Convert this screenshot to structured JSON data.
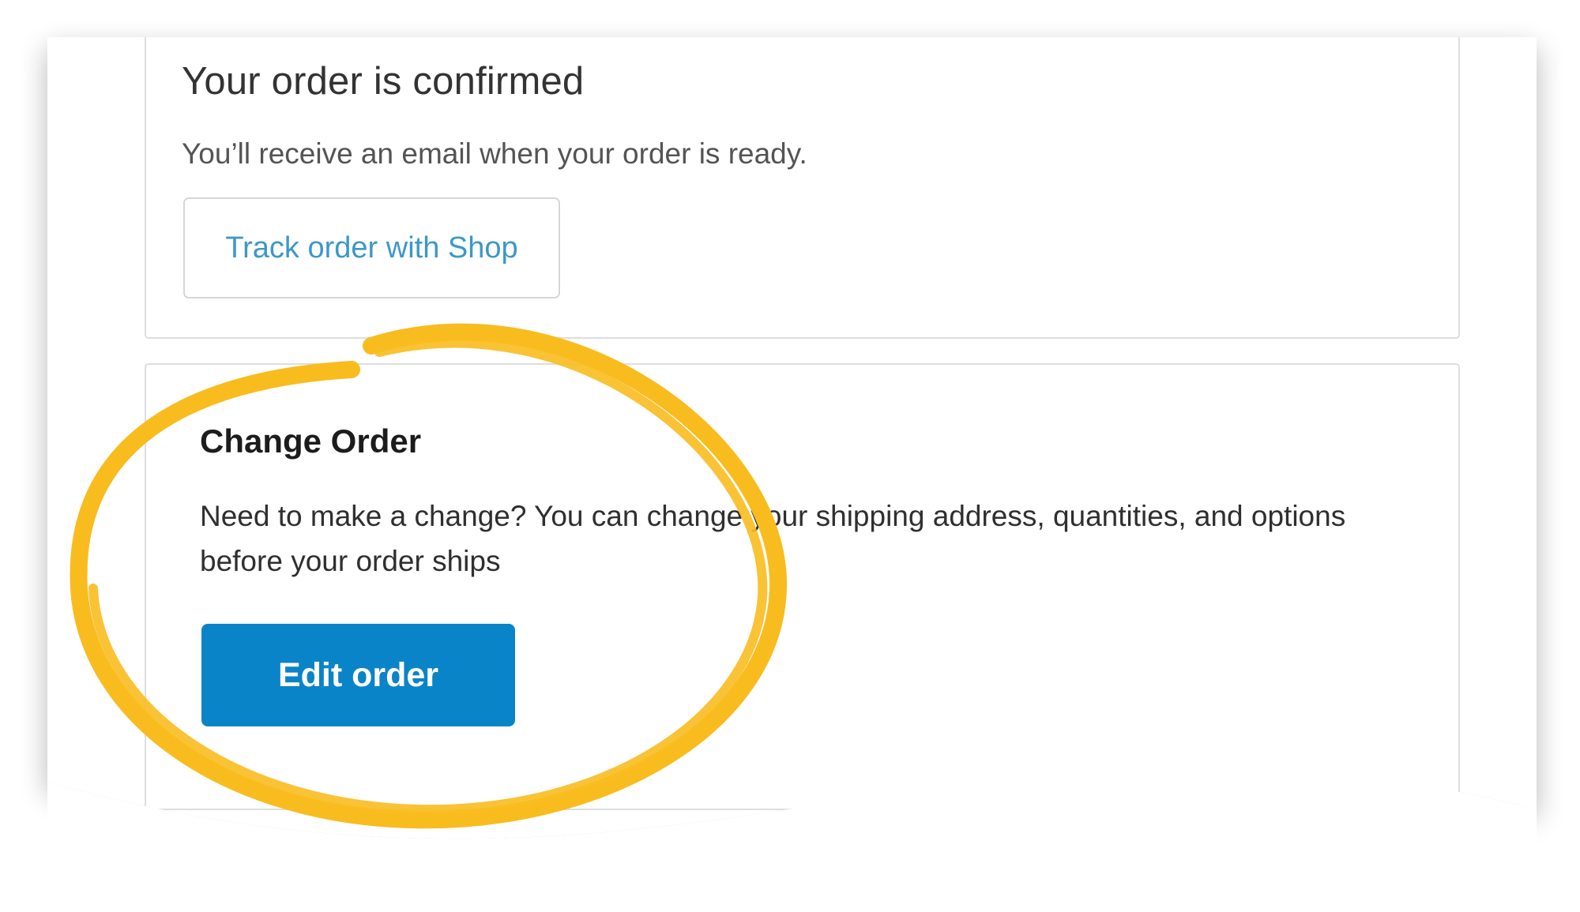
{
  "confirmation": {
    "title": "Your order is confirmed",
    "message": "You’ll receive an email when your order is ready.",
    "track_button_label": "Track order with Shop"
  },
  "change_order": {
    "title": "Change Order",
    "description": "Need to make a change? You can change your shipping address, quantities, and options before your order ships",
    "edit_button_label": "Edit order"
  },
  "colors": {
    "highlight": "#f9bc1f",
    "primary_button": "#0a84c8",
    "link_text": "#3c98c8"
  }
}
